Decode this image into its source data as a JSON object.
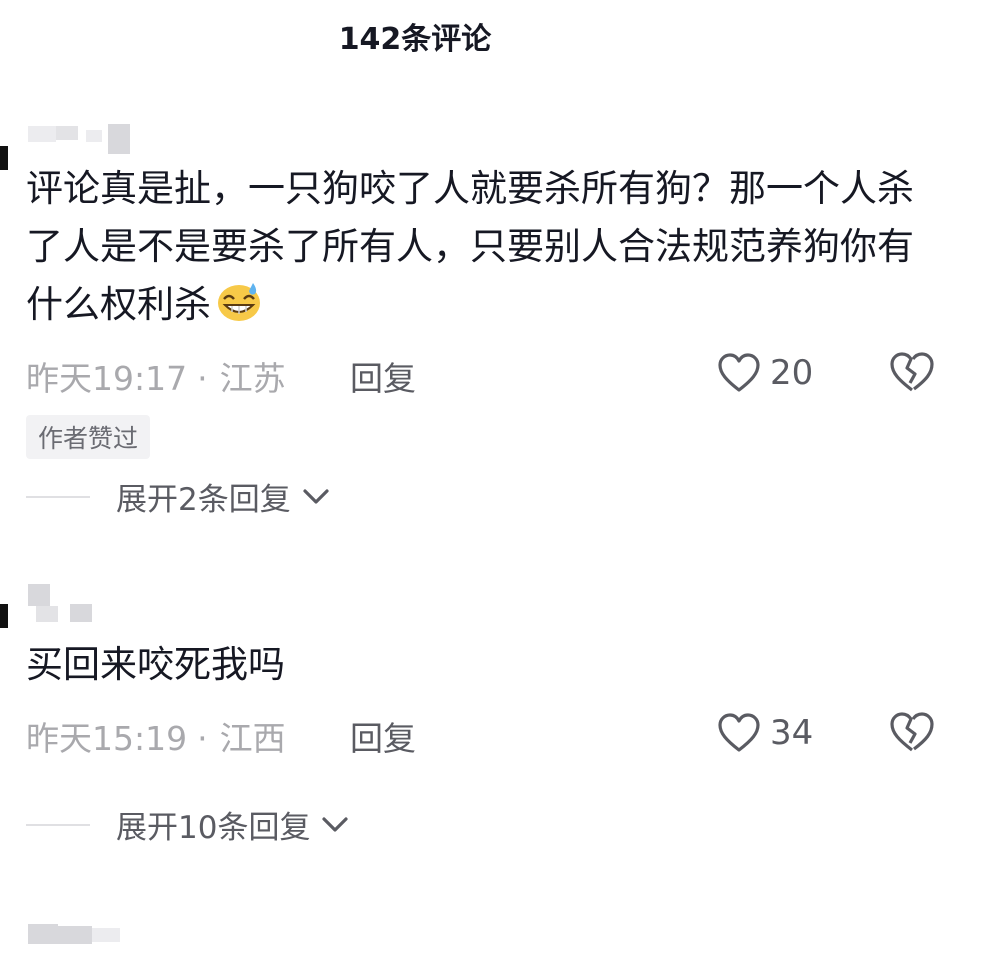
{
  "header": {
    "title": "142条评论"
  },
  "comments": [
    {
      "text": "评论真是扯，一只狗咬了人就要杀所有狗？那一个人杀了人是不是要杀了所有人，只要别人合法规范养狗你有什么权利杀",
      "emoji": "grinning-sweat-emoji",
      "time": "昨天19:17",
      "separator": "·",
      "location": "江苏",
      "reply_label": "回复",
      "likes": "20",
      "badge": "作者赞过",
      "expand_label": "展开2条回复"
    },
    {
      "text": "买回来咬死我吗",
      "time": "昨天15:19",
      "separator": "·",
      "location": "江西",
      "reply_label": "回复",
      "likes": "34",
      "expand_label": "展开10条回复"
    }
  ],
  "icons": {
    "like": "heart-outline-icon",
    "dislike": "broken-heart-icon",
    "expand": "chevron-down-icon"
  },
  "colors": {
    "text": "#161823",
    "meta": "#a9a9ad",
    "secondary": "#5a5b62",
    "badge_bg": "#f2f2f4"
  }
}
